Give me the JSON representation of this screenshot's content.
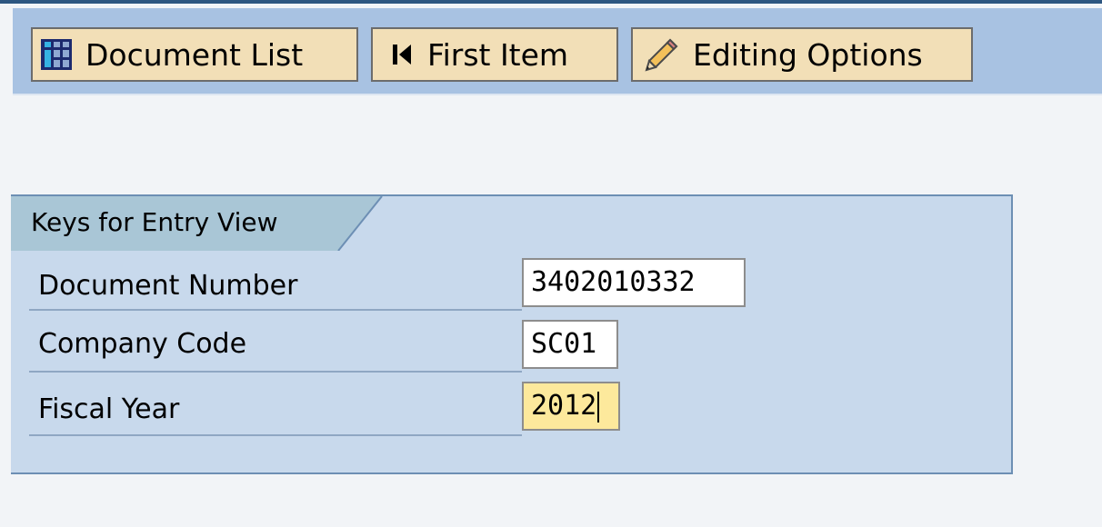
{
  "toolbar": {
    "buttons": [
      {
        "label": "Document List",
        "icon": "document-list-icon"
      },
      {
        "label": "First Item",
        "icon": "first-item-icon"
      },
      {
        "label": "Editing Options",
        "icon": "pencil-icon"
      }
    ]
  },
  "panel": {
    "title": "Keys for Entry View",
    "fields": [
      {
        "label": "Document Number",
        "value": "3402010332"
      },
      {
        "label": "Company Code",
        "value": "SC01"
      },
      {
        "label": "Fiscal Year",
        "value": "2012"
      }
    ]
  },
  "colors": {
    "toolbar_background": "#a8c2e2",
    "button_background": "#f2dfb7",
    "panel_background": "#c8d9ec",
    "panel_border": "#6d8fb4",
    "active_field": "#fde99c",
    "page_background": "#f2f4f7"
  }
}
